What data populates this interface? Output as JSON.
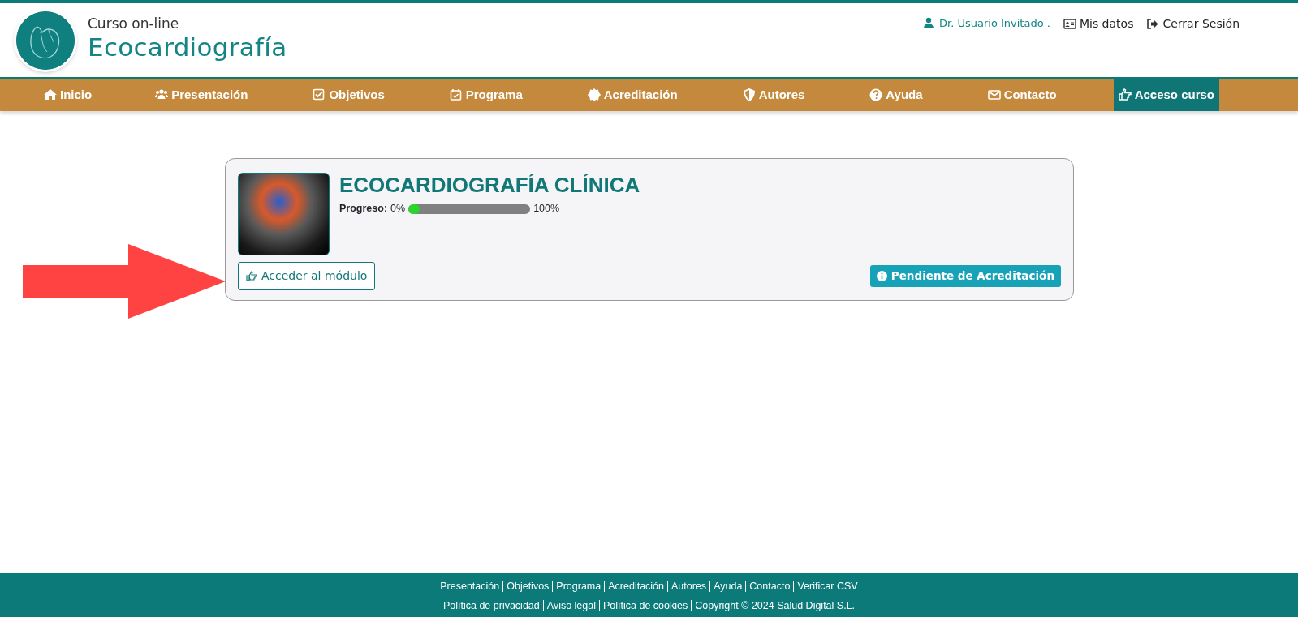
{
  "header": {
    "logo": {
      "subtitle": "Curso  on-line",
      "title": "Ecocardiografía"
    },
    "user_menu": [
      {
        "kind": "user",
        "label": "Dr. Usuario Invitado ."
      },
      {
        "kind": "data",
        "label": "Mis datos"
      },
      {
        "kind": "logout",
        "label": "Cerrar Sesión"
      }
    ]
  },
  "nav": [
    {
      "label": "Inicio",
      "selected": false
    },
    {
      "label": "Presentación",
      "selected": false
    },
    {
      "label": "Objetivos",
      "selected": false
    },
    {
      "label": "Programa",
      "selected": false
    },
    {
      "label": "Acreditación",
      "selected": false
    },
    {
      "label": "Autores",
      "selected": false
    },
    {
      "label": "Ayuda",
      "selected": false
    },
    {
      "label": "Contacto",
      "selected": false
    },
    {
      "label": "Acceso curso",
      "selected": true
    }
  ],
  "course": {
    "title": "ECOCARDIOGRAFÍA CLÍNICA",
    "progress_label": "Progreso:",
    "progress_min": "0%",
    "progress_max": "100%",
    "level": 0.03,
    "button": "Acceder al módulo",
    "status": "Pendiente de Acreditación"
  },
  "footer": {
    "site_links": [
      "Presentación",
      "Objetivos",
      "Programa",
      "Acreditación",
      "Autores",
      "Ayuda",
      "Contacto",
      "Verificar CSV"
    ],
    "legal_links": [
      "Política de privacidad",
      "Aviso legal",
      "Política de cookies",
      "Copyright © 2024 Salud Digital S.L."
    ]
  }
}
